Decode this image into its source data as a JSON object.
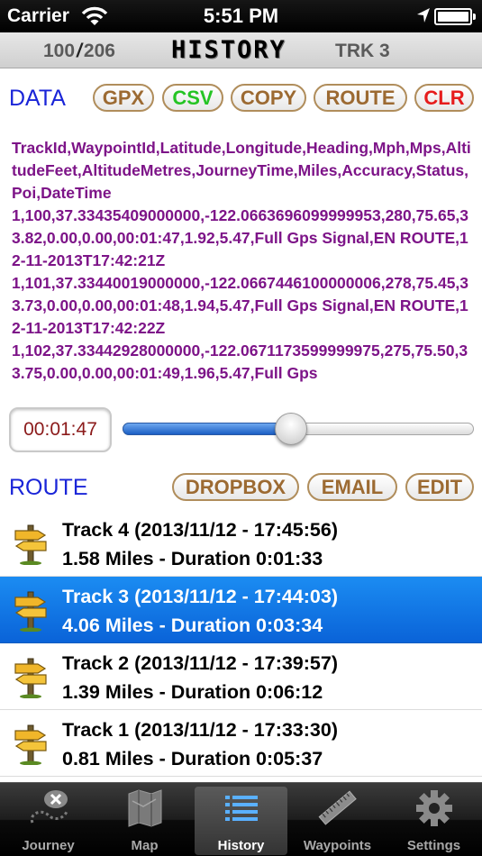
{
  "status_bar": {
    "carrier": "Carrier",
    "time": "5:51 PM"
  },
  "header": {
    "current": "100",
    "separator": "/",
    "total": "206",
    "title": "HISTORY",
    "track": "TRK 3"
  },
  "data_section": {
    "label": "DATA",
    "buttons": {
      "gpx": "GPX",
      "csv": "CSV",
      "copy": "COPY",
      "route": "ROUTE",
      "clr": "CLR"
    },
    "csv_text": "TrackId,WaypointId,Latitude,Longitude,Heading,Mph,Mps,AltitudeFeet,AltitudeMetres,JourneyTime,Miles,Accuracy,Status,Poi,DateTime\n1,100,37.33435409000000,-122.0663696099999953,280,75.65,33.82,0.00,0.00,00:01:47,1.92,5.47,Full Gps Signal,EN ROUTE,12-11-2013T17:42:21Z\n1,101,37.33440019000000,-122.0667446100000006,278,75.45,33.73,0.00,0.00,00:01:48,1.94,5.47,Full Gps Signal,EN ROUTE,12-11-2013T17:42:22Z\n1,102,37.33442928000000,-122.0671173599999975,275,75.50,33.75,0.00,0.00,00:01:49,1.96,5.47,Full Gps"
  },
  "playback": {
    "time": "00:01:47",
    "position": 0.48
  },
  "route_section": {
    "label": "ROUTE",
    "buttons": {
      "dropbox": "DROPBOX",
      "email": "EMAIL",
      "edit": "EDIT"
    },
    "tracks": [
      {
        "title": "Track 4 (2013/11/12 - 17:45:56)",
        "summary": "1.58 Miles - Duration 0:01:33",
        "selected": false
      },
      {
        "title": "Track 3 (2013/11/12 - 17:44:03)",
        "summary": "4.06 Miles - Duration 0:03:34",
        "selected": true
      },
      {
        "title": "Track 2 (2013/11/12 - 17:39:57)",
        "summary": "1.39 Miles - Duration 0:06:12",
        "selected": false
      },
      {
        "title": "Track 1 (2013/11/12 - 17:33:30)",
        "summary": "0.81 Miles - Duration 0:05:37",
        "selected": false
      }
    ]
  },
  "tab_bar": {
    "tabs": [
      {
        "label": "Journey",
        "icon": "journey-icon",
        "active": false
      },
      {
        "label": "Map",
        "icon": "map-icon",
        "active": false
      },
      {
        "label": "History",
        "icon": "list-icon",
        "active": true
      },
      {
        "label": "Waypoints",
        "icon": "ruler-icon",
        "active": false
      },
      {
        "label": "Settings",
        "icon": "gear-icon",
        "active": false
      }
    ]
  },
  "colors": {
    "data_label": "#1a25d8",
    "csv_text": "#7d1488",
    "selected_row": "#0a63d8",
    "csv_button": "#25c424",
    "clr_button": "#e61c1c"
  }
}
